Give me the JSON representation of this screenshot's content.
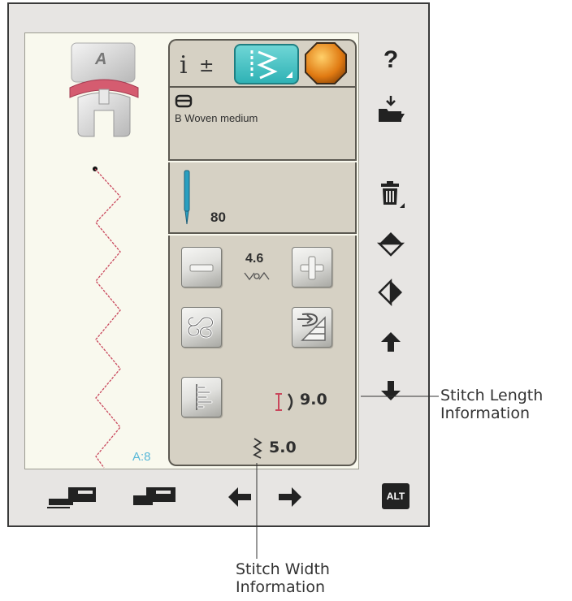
{
  "foot": {
    "letter": "A"
  },
  "fabric": {
    "name": "B Woven medium"
  },
  "needle": {
    "size": "80"
  },
  "stitch": {
    "width_value": "4.6",
    "length_value": "9.0",
    "width_display": "5.0",
    "pattern_id": "A:8"
  },
  "side_toolbar": {
    "help": "?",
    "alt_label": "ALT"
  },
  "callouts": {
    "length_line1": "Stitch Length",
    "length_line2": "Information",
    "width_line1": "Stitch Width",
    "width_line2": "Information"
  },
  "colors": {
    "teal_tab": "#38bfc0",
    "stitch_red": "#c9475c",
    "panel_bg": "#d6d1c4",
    "accent_orange": "#e07a12"
  },
  "icons": {
    "info_tab": "info-plus-icon",
    "stitch_tab": "zigzag-stitch-icon",
    "orange_tab": "octagon-icon",
    "presser_foot": "presser-foot-icon",
    "fabric": "fabric-icon",
    "needle": "needle-icon",
    "minus": "minus-icon",
    "plus": "plus-icon",
    "symmetry": "stitch-pattern-icon",
    "taper": "tapering-icon",
    "balance": "balance-icon",
    "length": "stitch-length-icon",
    "width": "stitch-width-icon",
    "save": "save-folder-icon",
    "delete": "trash-icon",
    "mirror_h": "mirror-horizontal-icon",
    "mirror_v": "mirror-vertical-icon",
    "up": "arrow-up-icon",
    "down": "arrow-down-icon",
    "left": "arrow-left-icon",
    "right": "arrow-right-icon",
    "single_stitch": "start-stitch-icon",
    "end_stitch": "end-stitch-icon",
    "alt": "alt-button"
  }
}
